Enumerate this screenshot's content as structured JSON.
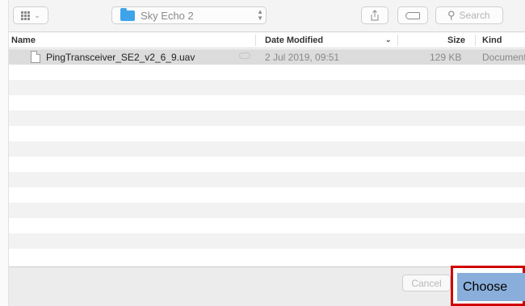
{
  "toolbar": {
    "view_icon": "icon-view-grid",
    "location": "Sky Echo 2",
    "location_icon": "folder-icon",
    "share_icon": "share-icon",
    "tag_icon": "tag-icon",
    "search_placeholder": "Search"
  },
  "columns": {
    "name": "Name",
    "date_modified": "Date Modified",
    "size": "Size",
    "kind": "Kind"
  },
  "files": [
    {
      "name": "PingTransceiver_SE2_v2_6_9.uav",
      "date_modified": "2 Jul 2019, 09:51",
      "size": "129 KB",
      "kind": "Document",
      "selected": true,
      "icon": "document-icon",
      "status_icon": "cloud-icon"
    }
  ],
  "footer": {
    "cancel_label": "Cancel",
    "choose_label": "Choose",
    "highlight_color": "#d00000",
    "choose_color": "#8aaedb"
  }
}
